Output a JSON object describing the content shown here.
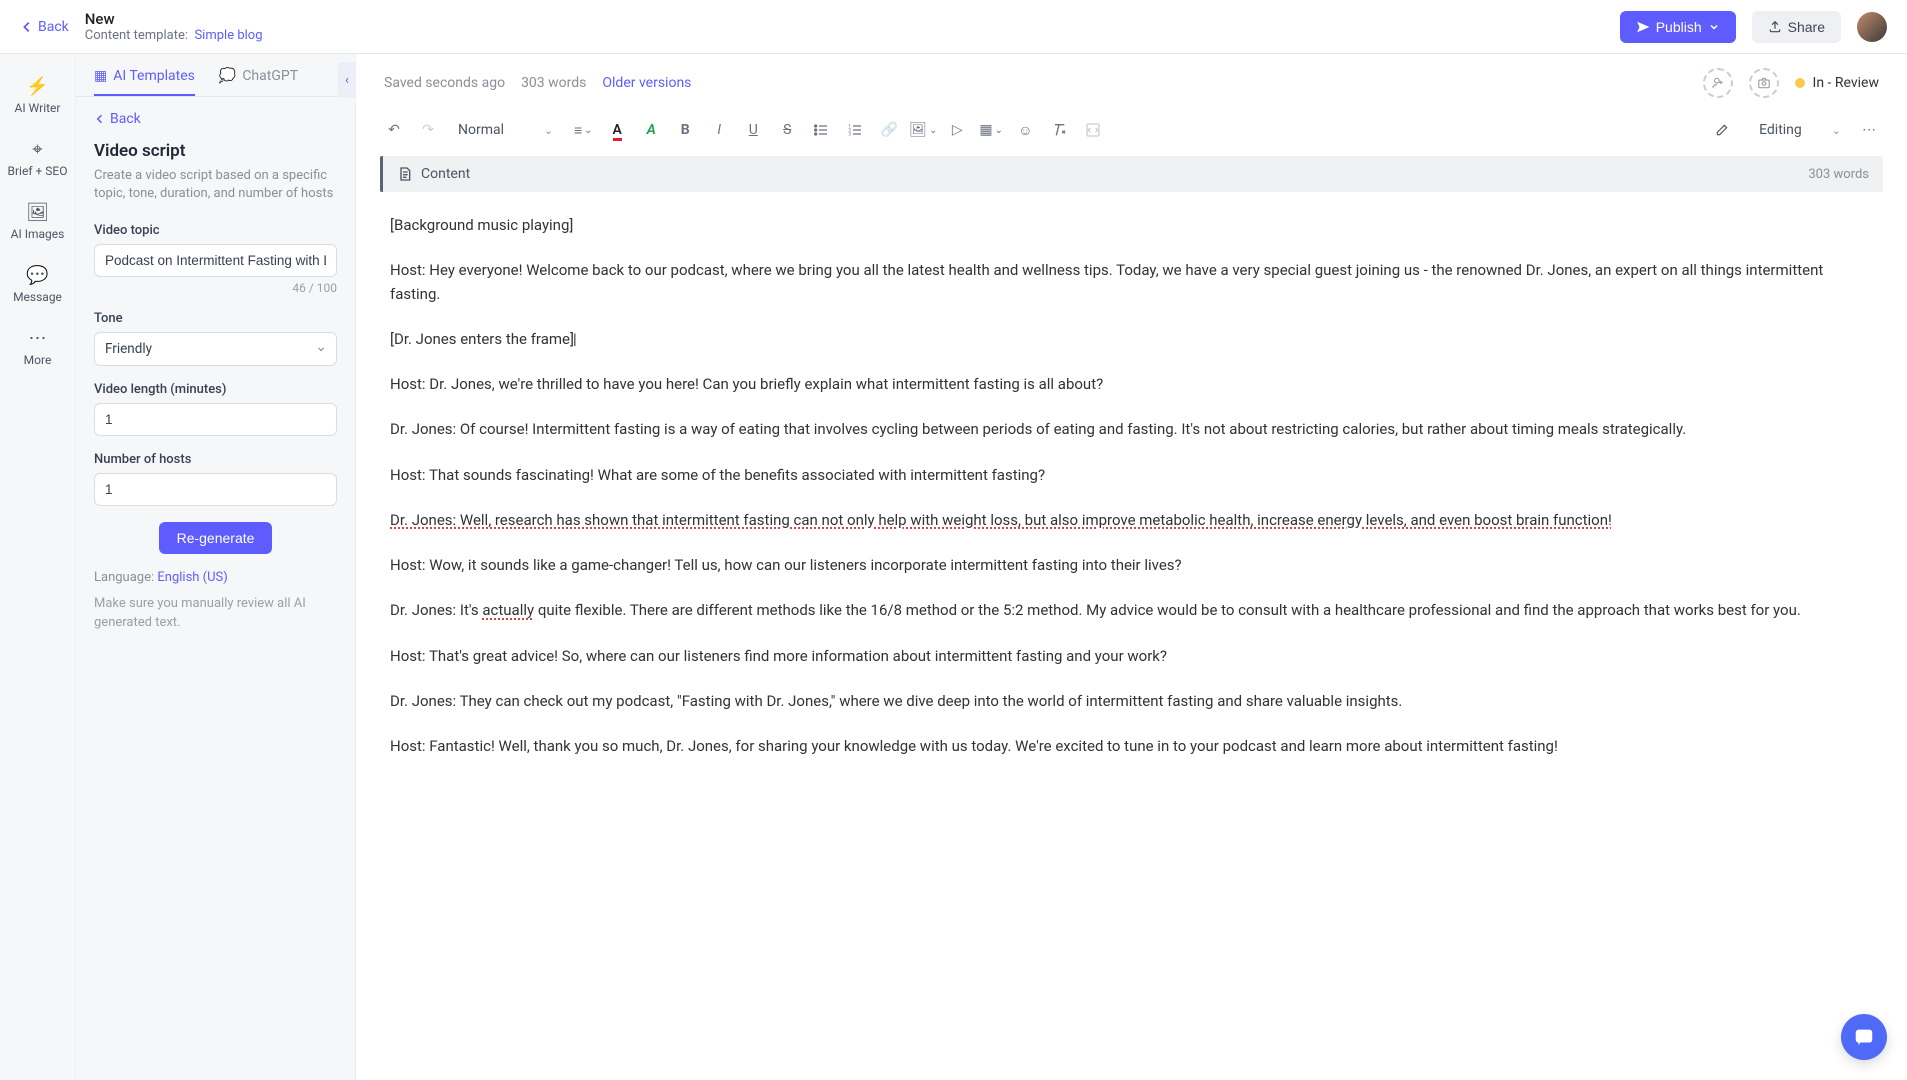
{
  "topbar": {
    "back": "Back",
    "title": "New",
    "template_label": "Content template:",
    "template_name": "Simple blog",
    "publish": "Publish",
    "share": "Share"
  },
  "rail": {
    "ai_writer": "AI Writer",
    "brief_seo": "Brief + SEO",
    "ai_images": "AI Images",
    "message": "Message",
    "more": "More"
  },
  "tabs": {
    "ai_templates": "AI Templates",
    "chatgpt": "ChatGPT"
  },
  "panel": {
    "back": "Back",
    "title": "Video script",
    "desc": "Create a video script based on a specific topic, tone, duration, and number of hosts",
    "topic_label": "Video topic",
    "topic_value": "Podcast on Intermittent Fasting with Dr. Jones",
    "topic_counter": "46 / 100",
    "tone_label": "Tone",
    "tone_value": "Friendly",
    "length_label": "Video length (minutes)",
    "length_value": "1",
    "hosts_label": "Number of hosts",
    "hosts_value": "1",
    "regenerate": "Re-generate",
    "language_label": "Language:",
    "language_value": "English (US)",
    "note": "Make sure you manually review all AI generated text."
  },
  "editor_meta": {
    "saved": "Saved seconds ago",
    "word_count_top": "303 words",
    "older_versions": "Older versions",
    "status_label": "In - Review",
    "style_normal": "Normal",
    "editing_label": "Editing",
    "content_label": "Content",
    "content_words": "303 words"
  },
  "doc": {
    "p1": "[Background music playing]",
    "p2": "Host: Hey everyone! Welcome back to our podcast, where we bring you all the latest health and wellness tips. Today, we have a very special guest joining us - the renowned Dr. Jones, an expert on all things intermittent fasting.",
    "p3": "[Dr. Jones enters the frame]",
    "p4": "Host: Dr. Jones, we're thrilled to have you here! Can you briefly explain what intermittent fasting is all about?",
    "p5": "Dr. Jones: Of course! Intermittent fasting is a way of eating that involves cycling between periods of eating and fasting. It's not about restricting calories, but rather about timing meals strategically.",
    "p6": "Host: That sounds fascinating! What are some of the benefits associated with intermittent fasting?",
    "p7": "Dr. Jones: Well, research has shown that intermittent fasting can not only help with weight loss, but also improve metabolic health, increase energy levels, and even boost brain function!",
    "p8": "Host: Wow, it sounds like a game-changer! Tell us, how can our listeners incorporate intermittent fasting into their lives?",
    "p9a": "Dr. Jones: It's ",
    "p9b": "actually",
    "p9c": " quite flexible. There are different methods like the 16/8 method or the 5:2 method. My advice would be to consult with a healthcare professional and find the approach that works best for you.",
    "p10": "Host: That's great advice! So, where can our listeners find more information about intermittent fasting and your work?",
    "p11": "Dr. Jones: They can check out my podcast, \"Fasting with Dr. Jones,\" where we dive deep into the world of intermittent fasting and share valuable insights.",
    "p12": "Host: Fantastic! Well, thank you so much, Dr. Jones, for sharing your knowledge with us today. We're excited to tune in to your podcast and learn more about intermittent fasting!"
  }
}
